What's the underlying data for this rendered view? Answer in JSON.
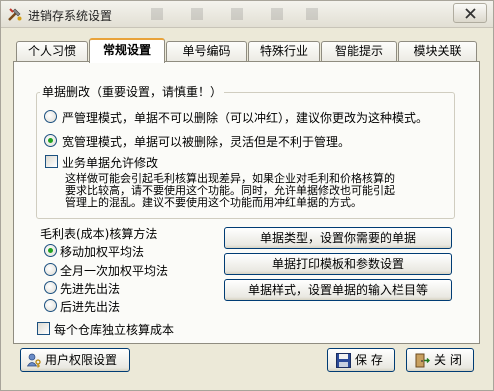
{
  "window": {
    "title": "进销存系统设置",
    "app_icon": "tools-icon",
    "close_icon": "close-icon"
  },
  "tabs": [
    {
      "label": "个人习惯",
      "active": false
    },
    {
      "label": "常规设置",
      "active": true
    },
    {
      "label": "单号编码",
      "active": false
    },
    {
      "label": "特殊行业",
      "active": false
    },
    {
      "label": "智能提示",
      "active": false
    },
    {
      "label": "模块关联",
      "active": false
    }
  ],
  "doc_edit": {
    "title": "单据删改（重要设置，请慎重！）",
    "options": [
      {
        "label": "严管理模式，单据不可以删除（可以冲红），建议你更改为这种模式。",
        "selected": false
      },
      {
        "label": "宽管理模式，单据可以被删除，灵活但是不利于管理。",
        "selected": true
      }
    ],
    "allow_modify": {
      "label": "业务单据允许修改",
      "checked": false
    },
    "warning_lines": [
      "这样做可能会引起毛利核算出现差异，如果企业对毛利和价格核算的",
      "要求比较高，请不要使用这个功能。同时，允许单据修改也可能引起",
      "管理上的混乱。建议不要使用这个功能而用冲红单据的方式。"
    ]
  },
  "cost": {
    "title": "毛利表(成本)核算方法",
    "options": [
      {
        "label": "移动加权平均法",
        "selected": true
      },
      {
        "label": "全月一次加权平均法",
        "selected": false
      },
      {
        "label": "先进先出法",
        "selected": false
      },
      {
        "label": "后进先出法",
        "selected": false
      }
    ],
    "per_warehouse": {
      "label": "每个仓库独立核算成本",
      "checked": false
    }
  },
  "actions": {
    "doc_types": "单据类型，设置你需要的单据",
    "print_templates": "单据打印模板和参数设置",
    "doc_style": "单据样式，设置单据的输入栏目等"
  },
  "footer": {
    "permissions": "用户权限设置",
    "permissions_icon": "user-key-icon",
    "save": "保 存",
    "save_icon": "floppy-disk-icon",
    "close": "关 闭",
    "close_icon": "exit-door-icon"
  },
  "colors": {
    "active_tab_accent": "#e9a33a",
    "button_border": "#003c74",
    "radio_dot": "#21a121"
  }
}
